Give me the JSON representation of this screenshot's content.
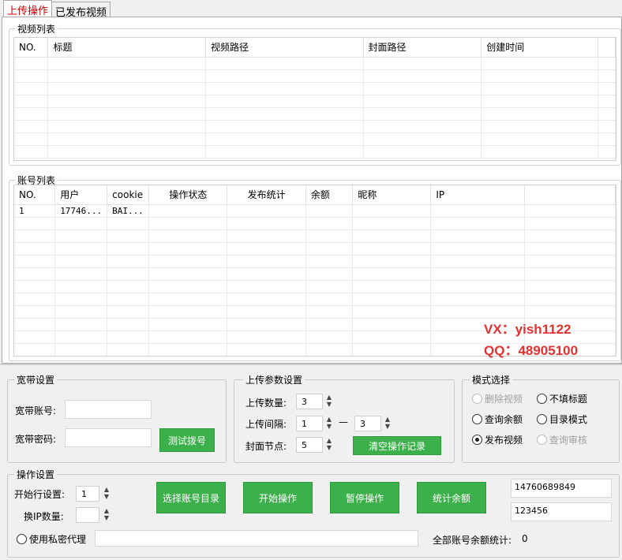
{
  "tabs": [
    {
      "label": "上传操作",
      "active": true
    },
    {
      "label": "已发布视频",
      "active": false
    }
  ],
  "video_list": {
    "title": "视频列表",
    "columns": [
      "NO.",
      "标题",
      "视频路径",
      "封面路径",
      "创建时间"
    ],
    "rows": []
  },
  "account_list": {
    "title": "账号列表",
    "columns": [
      "NO.",
      "用户",
      "cookie",
      "操作状态",
      "发布统计",
      "余额",
      "昵称",
      "IP"
    ],
    "rows": [
      [
        "1",
        "17746...",
        "BAI...",
        "",
        "",
        "",
        "",
        ""
      ]
    ]
  },
  "watermark": {
    "line1": "VX：yish1122",
    "line2": "QQ：48905100",
    "color": "#e53030"
  },
  "broadband": {
    "title": "宽带设置",
    "account_label": "宽带账号:",
    "account_value": "",
    "password_label": "宽带密码:",
    "password_value": "",
    "test_button": "测试拨号"
  },
  "upload_params": {
    "title": "上传参数设置",
    "count_label": "上传数量:",
    "count_value": "3",
    "interval_label": "上传间隔:",
    "interval_from": "1",
    "interval_sep": "—",
    "interval_to": "3",
    "cover_label": "封面节点:",
    "cover_value": "5",
    "clear_button": "清空操作记录"
  },
  "mode": {
    "title": "模式选择",
    "options": [
      {
        "label": "删除视频",
        "selected": false,
        "disabled": true
      },
      {
        "label": "不填标题",
        "selected": false,
        "disabled": false
      },
      {
        "label": "查询余额",
        "selected": false,
        "disabled": false
      },
      {
        "label": "目录模式",
        "selected": false,
        "disabled": false
      },
      {
        "label": "发布视频",
        "selected": true,
        "disabled": false
      },
      {
        "label": "查询审核",
        "selected": false,
        "disabled": true
      }
    ]
  },
  "operation": {
    "title": "操作设置",
    "start_row_label": "开始行设置:",
    "start_row_value": "1",
    "ip_count_label": "换IP数量:",
    "ip_count_value": "",
    "buttons": {
      "select_dir": "选择账号目录",
      "start": "开始操作",
      "pause": "暂停操作",
      "stats": "统计余额"
    },
    "field1": "14760689849",
    "field2": "123456",
    "proxy_label": "使用私密代理",
    "proxy_value": "",
    "total_label": "全部账号余额统计:",
    "total_value": "0"
  },
  "colors": {
    "accent_green": "#3cb04a",
    "active_tab_red": "#d00000"
  }
}
